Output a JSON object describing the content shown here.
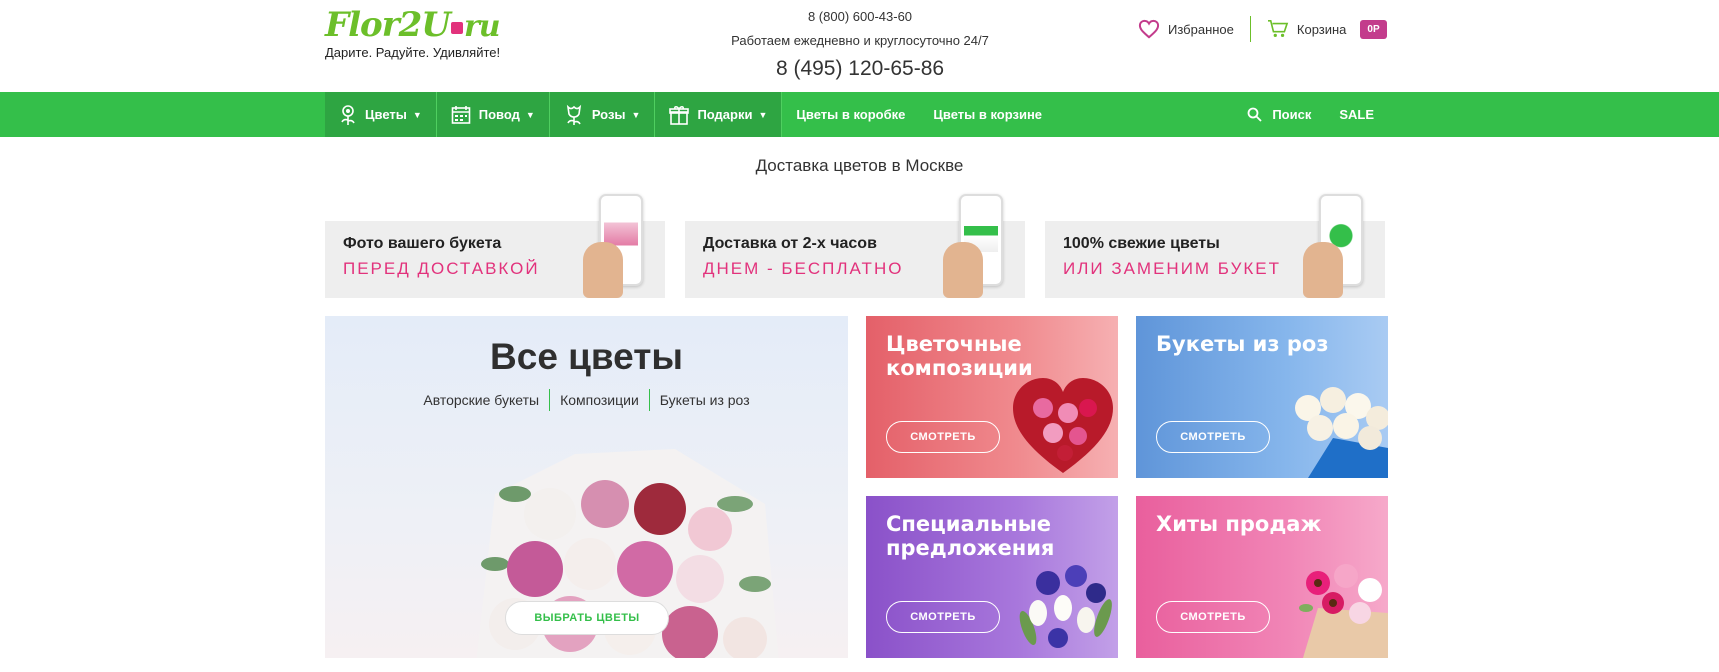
{
  "header": {
    "logo": {
      "main": "Flor2U",
      "suffix": "ru"
    },
    "tagline": "Дарите. Радуйте. Удивляйте!",
    "phone_small": "8 (800) 600-43-60",
    "hours": "Работаем ежедневно и круглосуточно 24/7",
    "phone_big": "8 (495) 120-65-86",
    "favorites_label": "Избранное",
    "cart_label": "Корзина",
    "cart_badge": "0Р",
    "accent_pink": "#e2327c",
    "accent_green": "#6cbf2a"
  },
  "nav": {
    "color": "#34bf4a",
    "items": [
      {
        "label": "Цветы",
        "icon": "flower-icon",
        "dropdown": true
      },
      {
        "label": "Повод",
        "icon": "calendar-icon",
        "dropdown": true
      },
      {
        "label": "Розы",
        "icon": "rose-icon",
        "dropdown": true
      },
      {
        "label": "Подарки",
        "icon": "gift-icon",
        "dropdown": true
      },
      {
        "label": "Цветы в коробке",
        "dropdown": false
      },
      {
        "label": "Цветы в корзине",
        "dropdown": false
      }
    ],
    "search_label": "Поиск",
    "sale_label": "SALE"
  },
  "delivery_title": "Доставка цветов в Москве",
  "features": [
    {
      "line1": "Фото вашего букета",
      "line2": "ПЕРЕД ДОСТАВКОЙ"
    },
    {
      "line1": "Доставка от 2-х часов",
      "line2": "ДНЕМ - БЕСПЛАТНО"
    },
    {
      "line1": "100% свежие цветы",
      "line2": "ИЛИ ЗАМЕНИМ БУКЕТ"
    }
  ],
  "main_tile": {
    "title": "Все цветы",
    "links": [
      "Авторские букеты",
      "Композиции",
      "Букеты из роз"
    ],
    "button": "ВЫБРАТЬ ЦВЕТЫ"
  },
  "tiles": [
    {
      "title_1": "Цветочные",
      "title_2": "композиции",
      "button": "СМОТРЕТЬ"
    },
    {
      "title_1": "Букеты из роз",
      "title_2": "",
      "button": "СМОТРЕТЬ"
    },
    {
      "title_1": "Специальные",
      "title_2": "предложения",
      "button": "СМОТРЕТЬ"
    },
    {
      "title_1": "Хиты продаж",
      "title_2": "",
      "button": "СМОТРЕТЬ"
    }
  ]
}
